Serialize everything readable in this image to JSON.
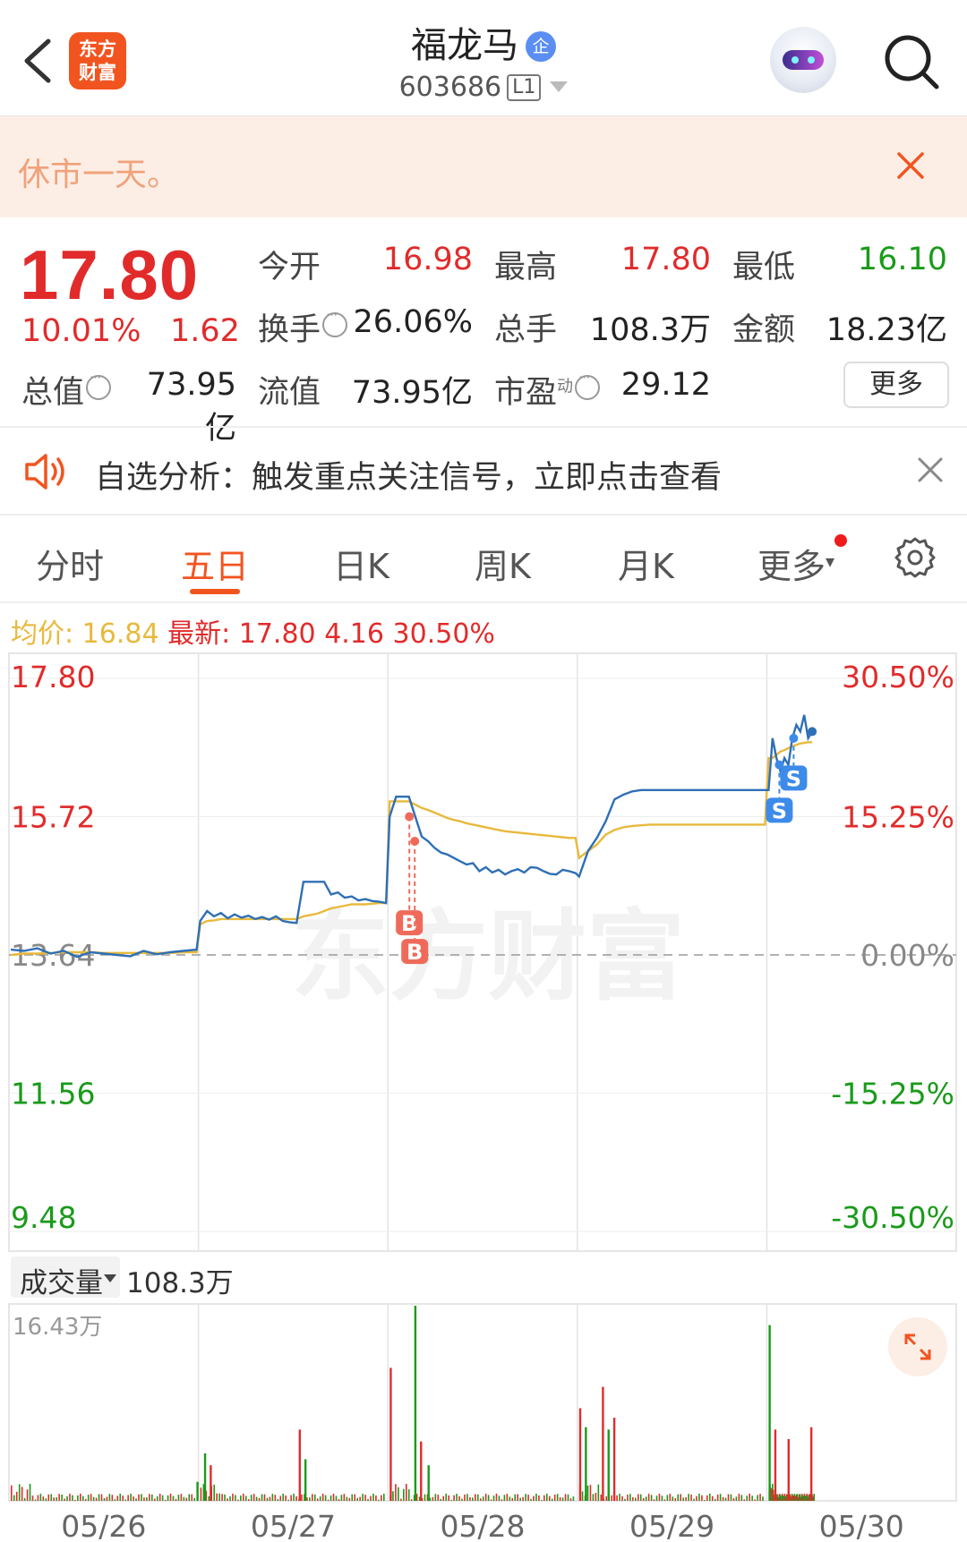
{
  "header": {
    "logo_line1": "东方",
    "logo_line2": "财富",
    "stock_name": "福龙马",
    "company_badge": "企",
    "stock_code": "603686",
    "level_badge": "L1",
    "icons": [
      "back-icon",
      "robot-assistant-icon",
      "search-icon"
    ]
  },
  "notice": {
    "text": "休市一天。"
  },
  "quote": {
    "price": "17.80",
    "change_pct": "10.01%",
    "change": "1.62",
    "open_label": "今开",
    "open": "16.98",
    "high_label": "最高",
    "high": "17.80",
    "low_label": "最低",
    "low": "16.10",
    "turnover_label": "换手",
    "turnover": "26.06%",
    "volume_label": "总手",
    "volume": "108.3万",
    "amount_label": "金额",
    "amount": "18.23亿",
    "mktcap_label": "总值",
    "mktcap": "73.95亿",
    "float_label": "流值",
    "float_cap": "73.95亿",
    "pe_label": "市盈",
    "pe_super": "动",
    "pe": "29.12",
    "more_button": "更多"
  },
  "signal": {
    "text": "自选分析：触发重点关注信号，立即点击查看"
  },
  "tabs": [
    {
      "label": "分时",
      "active": false
    },
    {
      "label": "五日",
      "active": true
    },
    {
      "label": "日K",
      "active": false
    },
    {
      "label": "周K",
      "active": false
    },
    {
      "label": "月K",
      "active": false
    },
    {
      "label": "更多",
      "active": false
    }
  ],
  "info_line": {
    "avg_label": "均价:",
    "avg_value": "16.84",
    "latest_label": "最新:",
    "latest_value": "17.80",
    "latest_change": "4.16",
    "latest_pct": "30.50%"
  },
  "colors": {
    "up": "#e12b2b",
    "down": "#1a9a1a",
    "price_line": "#2f6fb5",
    "avg_line": "#e8b93c",
    "accent": "#f2541f",
    "watermark": "东方财富"
  },
  "chart_data": {
    "type": "line",
    "title": "",
    "x_labels": [
      "05/26",
      "05/27",
      "05/28",
      "05/29",
      "05/30"
    ],
    "left_axis": [
      "17.80",
      "15.72",
      "13.64",
      "11.56",
      "9.48"
    ],
    "right_axis": [
      "30.50%",
      "15.25%",
      "0.00%",
      "-15.25%",
      "-30.50%"
    ],
    "ylim": [
      9.48,
      17.8
    ],
    "base_price": 13.64,
    "series": [
      {
        "values": [
          13.72,
          13.7,
          13.74,
          13.66,
          13.7,
          13.61,
          13.68,
          13.66,
          13.64,
          13.62,
          13.7,
          13.65,
          13.68,
          13.7,
          13.72,
          14.15,
          14.3,
          14.22,
          14.27,
          14.19,
          14.25,
          14.2,
          14.23,
          14.18,
          14.21,
          14.17,
          14.22,
          14.15,
          14.13,
          14.12,
          14.74,
          14.74,
          14.74,
          14.74,
          14.55,
          14.58,
          14.5,
          14.52,
          14.46,
          14.48,
          14.45,
          14.44,
          14.42,
          15.72,
          16.02,
          16.02,
          16.02,
          15.72,
          15.42,
          15.35,
          15.25,
          15.18,
          15.15,
          15.1,
          15.05,
          15.0,
          15.02,
          14.9,
          14.96,
          14.88,
          14.92,
          14.85,
          14.9,
          14.93,
          14.88,
          14.96,
          14.95,
          14.9,
          14.86,
          14.85,
          14.92,
          14.9,
          14.87,
          14.82,
          15.2,
          15.4,
          15.65,
          15.98,
          16.05,
          16.1,
          16.12,
          16.12,
          16.12,
          16.12,
          16.12,
          16.12,
          16.12,
          16.12,
          16.12,
          16.12,
          16.12,
          16.12,
          16.12,
          16.12,
          16.12,
          16.12,
          16.9,
          16.6,
          16.4,
          16.6,
          16.5,
          16.9,
          17.1,
          17.0,
          17.25,
          16.9,
          17.0,
          17.8
        ]
      },
      {
        "values": [
          13.64,
          13.66,
          13.66,
          13.67,
          13.68,
          13.68,
          13.68,
          13.67,
          13.67,
          13.67,
          13.67,
          13.67,
          13.67,
          13.68,
          13.68,
          14.1,
          14.15,
          14.16,
          14.18,
          14.18,
          14.18,
          14.18,
          14.18,
          14.18,
          14.18,
          14.18,
          14.18,
          14.18,
          14.18,
          14.18,
          14.22,
          14.24,
          14.26,
          14.3,
          14.34,
          14.36,
          14.38,
          14.4,
          14.4,
          14.4,
          14.41,
          14.42,
          14.42,
          15.95,
          15.95,
          15.95,
          15.95,
          15.9,
          15.85,
          15.82,
          15.78,
          15.74,
          15.7,
          15.67,
          15.65,
          15.62,
          15.6,
          15.58,
          15.56,
          15.54,
          15.52,
          15.5,
          15.49,
          15.48,
          15.47,
          15.46,
          15.45,
          15.44,
          15.43,
          15.42,
          15.41,
          15.4,
          15.4,
          15.1,
          15.2,
          15.3,
          15.45,
          15.52,
          15.56,
          15.58,
          15.59,
          15.6,
          15.6,
          15.6,
          15.6,
          15.6,
          15.6,
          15.6,
          15.6,
          15.6,
          15.6,
          15.6,
          15.6,
          15.6,
          15.6,
          16.6,
          16.6,
          16.65,
          16.7,
          16.72,
          16.75,
          16.78,
          16.8,
          16.82,
          16.83,
          16.84,
          16.84
        ]
      }
    ],
    "markers": [
      {
        "type": "buy",
        "label": "B",
        "value": 15.72
      },
      {
        "type": "buy",
        "label": "B",
        "value": 15.35
      },
      {
        "type": "sell",
        "label": "S",
        "value": 16.9
      },
      {
        "type": "sell",
        "label": "S",
        "value": 16.5
      }
    ]
  },
  "volume": {
    "selector_label": "成交量",
    "total": "108.3万",
    "max_label": "16.43万",
    "bars": [
      {
        "day": 0,
        "pos": 0.98,
        "value": 1.6,
        "up": false
      },
      {
        "day": 1,
        "pos": 0.02,
        "value": 4.0,
        "up": false
      },
      {
        "day": 1,
        "pos": 0.05,
        "value": 3.0,
        "up": true
      },
      {
        "day": 1,
        "pos": 0.52,
        "value": 6.0,
        "up": true
      },
      {
        "day": 1,
        "pos": 0.55,
        "value": 3.5,
        "up": false
      },
      {
        "day": 2,
        "pos": 0.0,
        "value": 11.2,
        "up": true
      },
      {
        "day": 2,
        "pos": 0.13,
        "value": 16.43,
        "up": false
      },
      {
        "day": 2,
        "pos": 0.16,
        "value": 5.0,
        "up": true
      },
      {
        "day": 2,
        "pos": 0.2,
        "value": 3.0,
        "up": false
      },
      {
        "day": 3,
        "pos": 0.0,
        "value": 7.8,
        "up": true
      },
      {
        "day": 3,
        "pos": 0.03,
        "value": 6.2,
        "up": false
      },
      {
        "day": 3,
        "pos": 0.12,
        "value": 9.6,
        "up": true
      },
      {
        "day": 3,
        "pos": 0.15,
        "value": 6.0,
        "up": false
      },
      {
        "day": 3,
        "pos": 0.18,
        "value": 7.0,
        "up": true
      },
      {
        "day": 4,
        "pos": 0.0,
        "value": 14.8,
        "up": false
      },
      {
        "day": 4,
        "pos": 0.03,
        "value": 6.0,
        "up": true
      },
      {
        "day": 4,
        "pos": 0.1,
        "value": 5.2,
        "up": true
      },
      {
        "day": 4,
        "pos": 0.22,
        "value": 6.2,
        "up": true
      }
    ]
  }
}
